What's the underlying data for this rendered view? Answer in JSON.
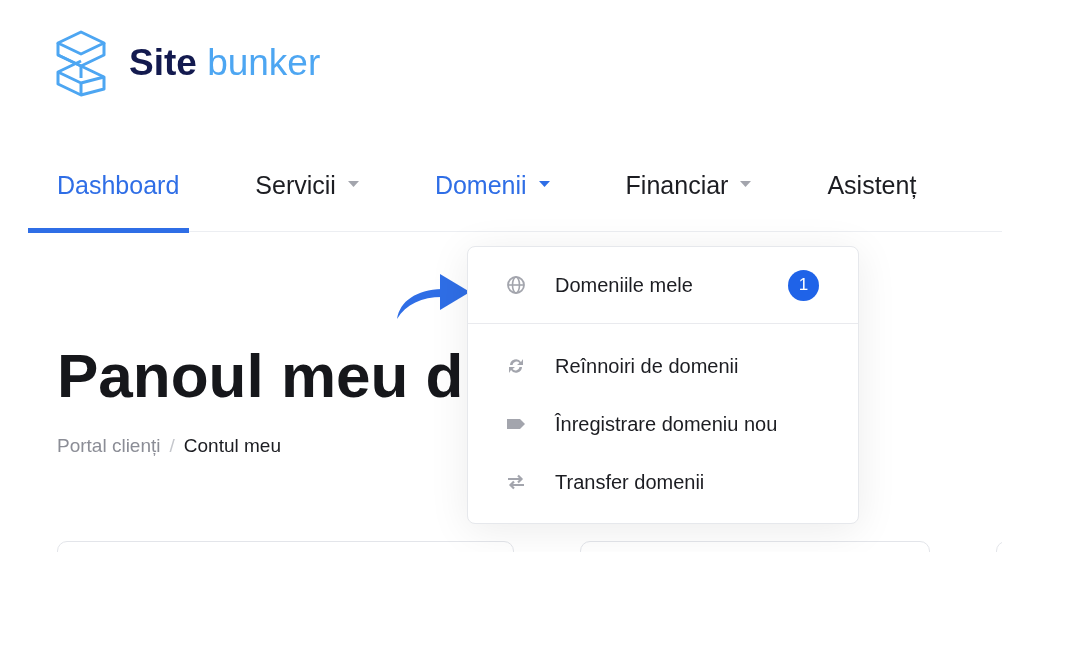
{
  "logo": {
    "primary": "Site",
    "secondary": "bunker"
  },
  "nav": [
    {
      "label": "Dashboard",
      "selected": true,
      "expanded": false,
      "dropdown": false
    },
    {
      "label": "Servicii",
      "selected": false,
      "expanded": false,
      "dropdown": true
    },
    {
      "label": "Domenii",
      "selected": false,
      "expanded": true,
      "dropdown": true
    },
    {
      "label": "Financiar",
      "selected": false,
      "expanded": false,
      "dropdown": true
    },
    {
      "label": "Asistenț",
      "selected": false,
      "expanded": false,
      "dropdown": false
    }
  ],
  "page_title": "Panoul meu d",
  "breadcrumb": [
    {
      "label": "Portal clienți",
      "kind": "link"
    },
    {
      "label": "/",
      "kind": "separator"
    },
    {
      "label": "Contul meu",
      "kind": "current"
    }
  ],
  "menu": {
    "sections": [
      [
        {
          "label": "Domeniile mele",
          "badge": "1"
        }
      ],
      [
        {
          "label": "Reînnoiri de domenii"
        },
        {
          "label": "Înregistrare domeniu nou"
        },
        {
          "label": "Transfer domenii"
        }
      ]
    ]
  }
}
